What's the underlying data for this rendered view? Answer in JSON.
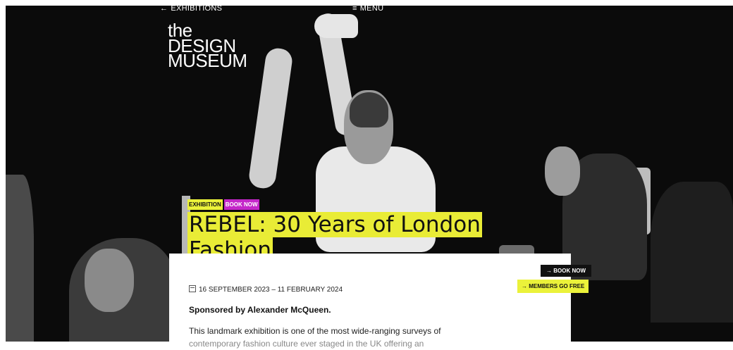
{
  "nav": {
    "back_arrow": "←",
    "back_label": "EXHIBITIONS",
    "menu_icon": "≡",
    "menu_label": "MENU"
  },
  "logo": {
    "line1": "the",
    "line2": "DESIGN",
    "line3": "MUSEUM"
  },
  "tags": {
    "exhibition": "EXHIBITION",
    "book_now": "BOOK NOW"
  },
  "exhibition": {
    "title_line1": "REBEL: 30 Years of London",
    "title_line2": "Fashion",
    "dates": "16 SEPTEMBER 2023 – 11 FEBRUARY 2024",
    "sponsor": "Sponsored by Alexander McQueen.",
    "description_line1": "This landmark exhibition is one of the most wide-ranging surveys of",
    "description_line2": "contemporary fashion culture ever staged in the UK offering an"
  },
  "buttons": {
    "book_now": "→ BOOK NOW",
    "members_go_free": "→ MEMBERS GO FREE"
  },
  "colors": {
    "accent_yellow": "#ebf23a",
    "accent_magenta": "#c426c9",
    "hero_bg": "#0b0b0b"
  }
}
